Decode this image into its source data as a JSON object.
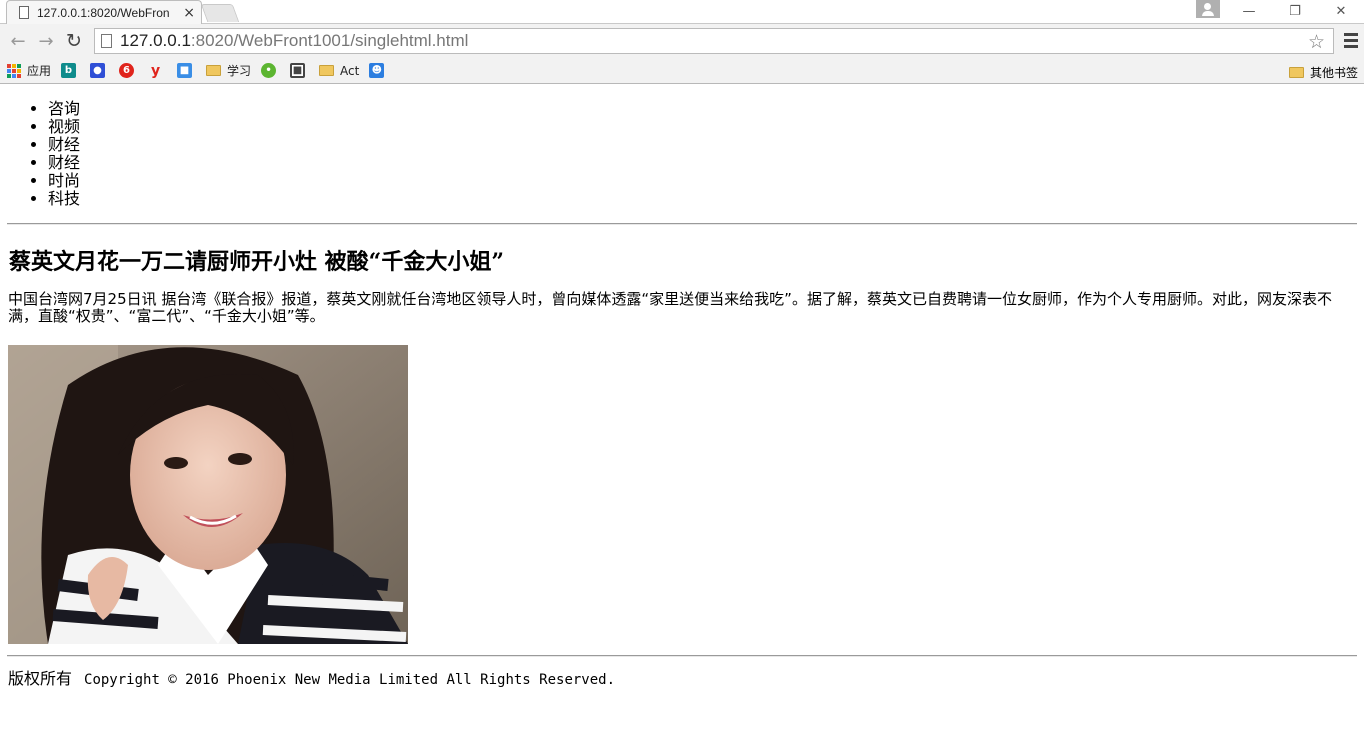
{
  "browser": {
    "tab_title": "127.0.0.1:8020/WebFron",
    "tab_close": "×",
    "url_host": "127.0.0.1",
    "url_rest": ":8020/WebFront1001/singlehtml.html",
    "bookmarks": [
      {
        "label": "应用",
        "icon": "apps-icon"
      },
      {
        "label": "",
        "icon": "bing-icon",
        "color": "#0f8c8c"
      },
      {
        "label": "",
        "icon": "baidu-icon",
        "color": "#2f4fd6"
      },
      {
        "label": "",
        "icon": "weibo-icon",
        "color": "#e0241c"
      },
      {
        "label": "",
        "icon": "youku-icon",
        "color": "#e0241c"
      },
      {
        "label": "",
        "icon": "photo-icon",
        "color": "#3a8ee6"
      },
      {
        "label": "学习",
        "icon": "folder-icon"
      },
      {
        "label": "",
        "icon": "chat-icon",
        "color": "#5cb531"
      },
      {
        "label": "",
        "icon": "tv-icon",
        "color": "#444444"
      },
      {
        "label": "Act",
        "icon": "folder-icon"
      },
      {
        "label": "",
        "icon": "app-icon",
        "color": "#2c7ee0"
      }
    ],
    "other_bookmarks": "其他书签"
  },
  "nav": [
    "咨询",
    "视频",
    "财经",
    "财经",
    "时尚",
    "科技"
  ],
  "article": {
    "headline": "蔡英文月花一万二请厨师开小灶 被酸“千金大小姐”",
    "body": "中国台湾网7月25日讯 据台湾《联合报》报道，蔡英文刚就任台湾地区领导人时，曾向媒体透露“家里送便当来给我吃”。据了解，蔡英文已自费聘请一位女厨师，作为个人专用厨师。对此，网友深表不满，直酸“权贵”、“富二代”、“千金大小姐”等。"
  },
  "footer": {
    "label": "版权所有",
    "copyright": "Copyright © 2016 Phoenix New Media Limited All Rights Reserved."
  }
}
